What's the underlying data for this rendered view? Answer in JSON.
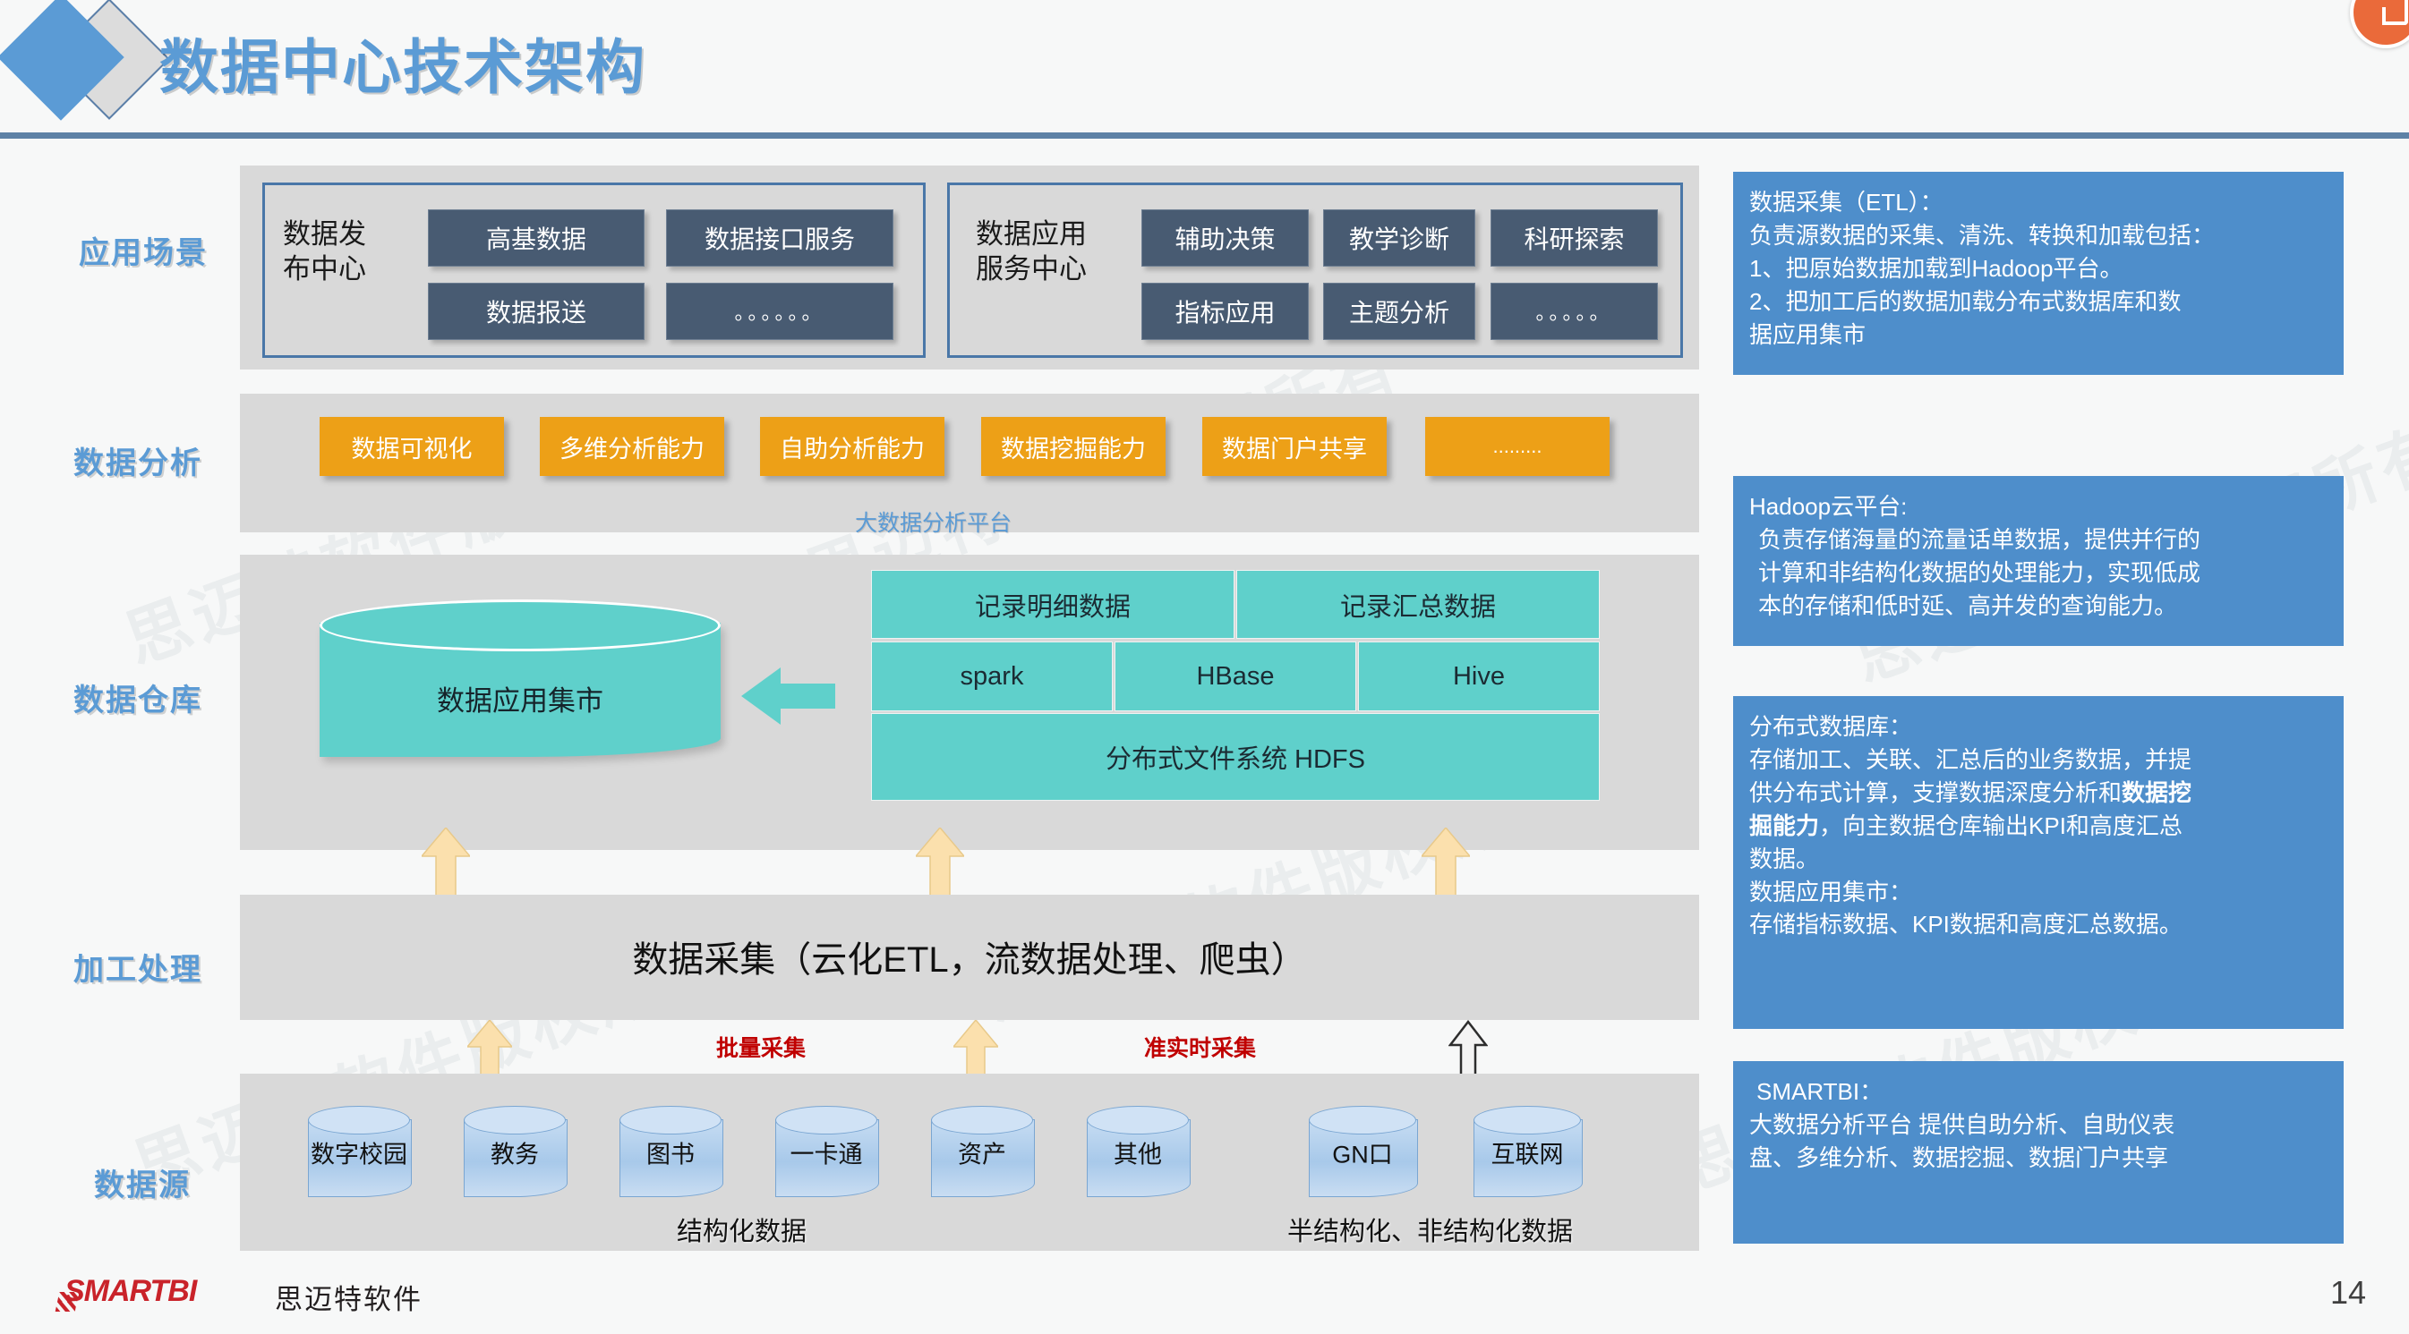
{
  "header": {
    "title": "数据中心技术架构",
    "badge_icon": "ppt-convert-icon"
  },
  "rows": [
    {
      "label": "应用场景"
    },
    {
      "label": "数据分析"
    },
    {
      "label": "数据仓库"
    },
    {
      "label": "加工处理"
    },
    {
      "label": "数据源"
    }
  ],
  "application_scenarios": {
    "groups": [
      {
        "name": "数据发\n布中心",
        "name_line1": "数据发",
        "name_line2": "布中心",
        "chips": [
          "高基数据",
          "数据接口服务",
          "数据报送",
          "。。。。。。"
        ]
      },
      {
        "name_line1": "数据应用",
        "name_line2": "服务中心",
        "chips": [
          "辅助决策",
          "教学诊断",
          "科研探索",
          "指标应用",
          "主题分析",
          "。。。。。"
        ]
      }
    ]
  },
  "data_analysis": {
    "chips": [
      "数据可视化",
      "多维分析能力",
      "自助分析能力",
      "数据挖掘能力",
      "数据门户共享",
      "........."
    ],
    "platform_label": "大数据分析平台"
  },
  "data_warehouse": {
    "mart_label": "数据应用集市",
    "arrow_icon": "left-arrow-icon",
    "top_row": [
      "记录明细数据",
      "记录汇总数据"
    ],
    "middle_row": [
      "spark",
      "HBase",
      "Hive"
    ],
    "bottom_row": "分布式文件系统 HDFS"
  },
  "processing": {
    "title": "数据采集（云化ETL，流数据处理、爬虫）",
    "collect_labels": [
      "批量采集",
      "准实时采集"
    ]
  },
  "data_sources": {
    "structured": [
      "数字校园",
      "教务",
      "图书",
      "一卡通",
      "资产",
      "其他"
    ],
    "unstructured": [
      "GN口",
      "互联网"
    ],
    "structured_label": "结构化数据",
    "unstructured_label": "半结构化、非结构化数据"
  },
  "info_panels": [
    {
      "lines": [
        "数据采集（ETL）：",
        "负责源数据的采集、清洗、转换和加载包括：",
        "1、把原始数据加载到Hadoop平台。",
        "2、把加工后的数据加载分布式数据库和数",
        "据应用集市"
      ]
    },
    {
      "lines": [
        "Hadoop云平台:",
        "负责存储海量的流量话单数据，提供并行的",
        "计算和非结构化数据的处理能力，实现低成",
        "本的存储和低时延、高并发的查询能力。"
      ]
    },
    {
      "lines": [
        "分布式数据库：",
        "存储加工、关联、汇总后的业务数据，并提",
        "供分布式计算，支撑数据深度分析和",
        "，向主数据仓库输出KPI和高度汇总",
        "数据。",
        "数据应用集市：",
        "存储指标数据、KPI数据和高度汇总数据。"
      ],
      "bold_1": "数据挖",
      "bold_2": "掘能力"
    },
    {
      "lines": [
        "SMARTBI：",
        "大数据分析平台 提供自助分析、自助仪表",
        "盘、多维分析、数据挖掘、数据门户共享"
      ]
    }
  ],
  "footer": {
    "logo_text": "SMARTBI",
    "company": "思迈特软件",
    "page_number": "14"
  },
  "watermark_text": "思迈特软件版权所有",
  "colors": {
    "title_blue": "#5b9bd5",
    "panel_blue": "#4e8ecb",
    "chip_dark": "#485b72",
    "chip_orange": "#eda017",
    "teal": "#5fd0cb",
    "band_gray": "#d9d9d9",
    "collect_red": "#c00000",
    "logo_red": "#c9232a"
  }
}
